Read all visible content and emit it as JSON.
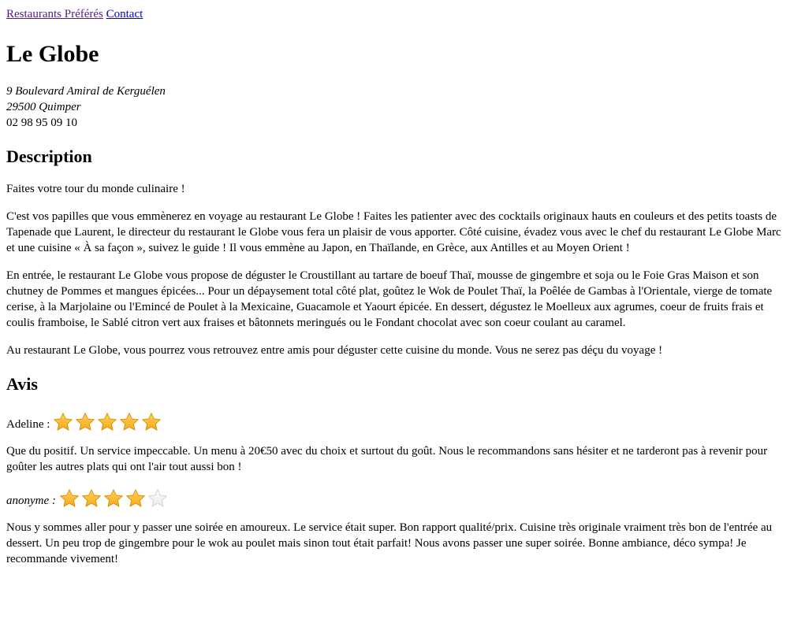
{
  "nav": {
    "favorites_label": "Restaurants Préférés",
    "contact_label": "Contact"
  },
  "restaurant": {
    "name": "Le Globe",
    "address_line1": "9 Boulevard Amiral de Kerguélen",
    "address_line2": "29500 Quimper",
    "phone": "02 98 95 09 10"
  },
  "description": {
    "heading": "Description",
    "paragraphs": [
      "Faites votre tour du monde culinaire !",
      "C'est vos papilles que vous emmènerez en voyage au restaurant Le Globe ! Faites les patienter avec des cocktails originaux hauts en couleurs et des petits toasts de Tapenade que Laurent, le directeur du restaurant le Globe vous fera un plaisir de vous apporter. Côté cuisine, évadez vous avec le chef du restaurant Le Globe Marc et une cuisine « À sa façon », suivez le guide ! Il vous emmène au Japon, en Thaïlande, en Grèce, aux Antilles et au Moyen Orient !",
      "En entrée, le restaurant Le Globe vous propose de déguster le Croustillant au tartare de boeuf Thaï, mousse de gingembre et soja ou le Foie Gras Maison et son chutney de Pommes et mangues épicées... Pour un dépaysement total côté plat, goûtez le Wok de Poulet Thaï, la Poêlée de Gambas à l'Orientale, vierge de tomate cerise, à la Marjolaine ou l'Emincé de Poulet à la Mexicaine, Guacamole et Yaourt épicée. En dessert, dégustez le Moelleux aux agrumes, coeur de fruits frais et coulis framboise, le Sablé citron vert aux fraises et bâtonnets meringués ou le Fondant chocolat avec son coeur coulant au caramel.",
      "Au restaurant Le Globe, vous pourrez vous retrouvez entre amis pour déguster cette cuisine du monde. Vous ne serez pas déçu du voyage !"
    ]
  },
  "reviews": {
    "heading": "Avis",
    "items": [
      {
        "author": "Adeline :",
        "rating": 5,
        "max_rating": 5,
        "text": "Que du positif. Un service impeccable. Un menu à 20€50 avec du choix et surtout du goût. Nous le recommandons sans hésiter et ne tarderont pas à revenir pour goûter les autres plats qui ont l'air tout aussi bon !"
      },
      {
        "author": "anonyme :",
        "rating": 4,
        "max_rating": 5,
        "text": "Nous y sommes aller pour y passer une soirée en amoureux. Le service était super. Bon rapport qualité/prix. Cuisine très originale vraiment très bon de l'entrée au dessert. Un peu trop de gingembre pour le wok au poulet mais sinon tout était parfait! Nous avons passer une super soirée. Bonne ambiance, déco sympa! Je recommande vivement!"
      }
    ]
  },
  "colors": {
    "star_filled": "#f5a91a",
    "star_empty": "#e8e8e8"
  }
}
